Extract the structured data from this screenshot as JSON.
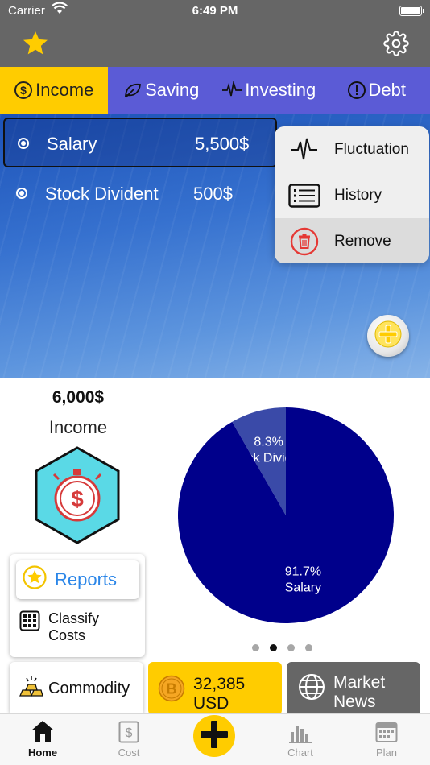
{
  "status_bar": {
    "carrier": "Carrier",
    "time": "6:49 PM"
  },
  "tabs": [
    {
      "label": "Income",
      "icon": "dollar-circle-icon",
      "active": true
    },
    {
      "label": "Saving",
      "icon": "leaf-icon",
      "active": false
    },
    {
      "label": "Investing",
      "icon": "pulse-icon",
      "active": false
    },
    {
      "label": "Debt",
      "icon": "alert-circle-icon",
      "active": false
    }
  ],
  "income_items": [
    {
      "name": "Salary",
      "amount": "5,500$",
      "selected": true
    },
    {
      "name": "Stock Divident",
      "amount": "500$",
      "selected": false
    }
  ],
  "context_menu": [
    {
      "label": "Fluctuation",
      "icon": "fluctuation-icon"
    },
    {
      "label": "History",
      "icon": "history-icon"
    },
    {
      "label": "Remove",
      "icon": "trash-icon"
    }
  ],
  "summary": {
    "amount": "6,000$",
    "label": "Income"
  },
  "chart_data": {
    "type": "pie",
    "slices": [
      {
        "label": "Stock Divident",
        "percent_label": "8.3%",
        "value": 8.3,
        "color": "#3a4aa8"
      },
      {
        "label": "Salary",
        "percent_label": "91.7%",
        "value": 91.7,
        "color": "#00008b"
      }
    ]
  },
  "pager": {
    "count": 4,
    "active_index": 1
  },
  "actions": {
    "reports_label": "Reports",
    "classify_line1": "Classify",
    "classify_line2": "Costs"
  },
  "tiles": {
    "commodity": "Commodity",
    "bitcoin_value": "32,385",
    "bitcoin_unit": "USD",
    "news_line1": "Market",
    "news_line2": "News"
  },
  "tabbar": [
    {
      "label": "Home",
      "active": true
    },
    {
      "label": "Cost",
      "active": false
    },
    {
      "label": "Chart",
      "active": false
    },
    {
      "label": "Plan",
      "active": false
    }
  ],
  "colors": {
    "accent_yellow": "#ffcc00",
    "tab_purple": "#5b5bd6",
    "header_gray": "#666666",
    "pie_dark_blue": "#00008b",
    "link_blue": "#2b86e8"
  }
}
